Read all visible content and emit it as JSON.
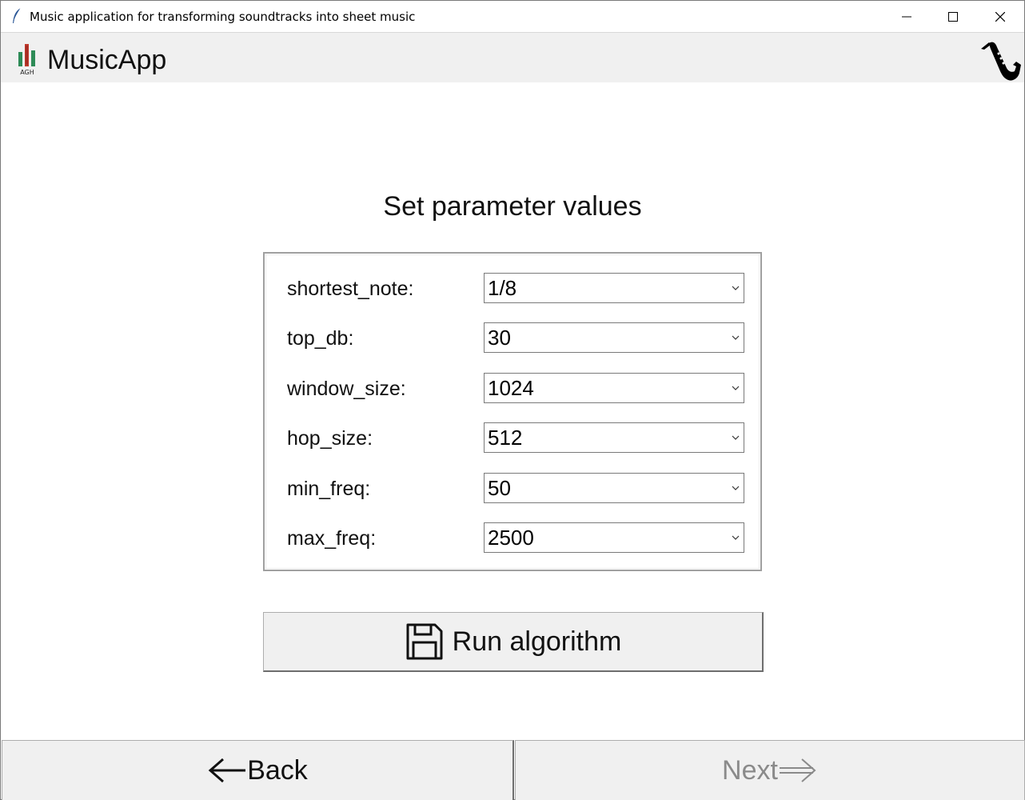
{
  "window": {
    "title": "Music application for transforming soundtracks into sheet music"
  },
  "header": {
    "brand": "MusicApp",
    "logo_text": "AGH"
  },
  "main": {
    "title": "Set parameter values",
    "params": [
      {
        "label": "shortest_note:",
        "value": "1/8"
      },
      {
        "label": "top_db:",
        "value": "30"
      },
      {
        "label": "window_size:",
        "value": "1024"
      },
      {
        "label": "hop_size:",
        "value": "512"
      },
      {
        "label": "min_freq:",
        "value": "50"
      },
      {
        "label": "max_freq:",
        "value": "2500"
      }
    ],
    "run_button_label": "Run algorithm"
  },
  "footer": {
    "back_label": "Back",
    "next_label": "Next"
  },
  "icons": {
    "app": "feather-icon",
    "logo": "agh-logo-icon",
    "header_right": "saxophone-icon",
    "run": "save-icon",
    "back": "arrow-left-icon",
    "next": "arrow-right-icon"
  },
  "colors": {
    "header_bg": "#f0f0f0",
    "button_bg": "#f0f0f0",
    "disabled_text": "#8a8a8a",
    "logo_green": "#2e8b57",
    "logo_red": "#c0392b"
  }
}
